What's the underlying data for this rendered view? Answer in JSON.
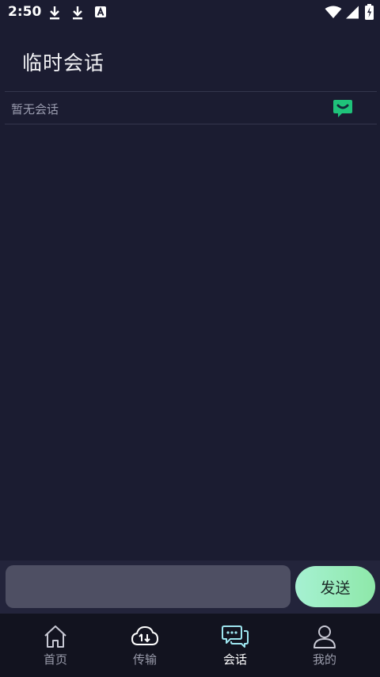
{
  "status_bar": {
    "time": "2:50",
    "icons": [
      "download-icon",
      "download-icon",
      "a-letter-icon",
      "wifi-icon",
      "signal-icon",
      "battery-icon"
    ]
  },
  "page": {
    "title": "临时会话",
    "empty_text": "暂无会话",
    "badge_icon": "chat-smile-icon",
    "badge_color": "#1fc27a"
  },
  "composer": {
    "input_value": "",
    "input_placeholder": "",
    "send_label": "发送",
    "send_gradient": [
      "#a6f1d2",
      "#8ee8a9"
    ]
  },
  "tabs": [
    {
      "label": "首页",
      "icon": "home-icon",
      "active": false
    },
    {
      "label": "传输",
      "icon": "cloud-transfer-icon",
      "active": false
    },
    {
      "label": "会话",
      "icon": "chat-bubbles-icon",
      "active": true
    },
    {
      "label": "我的",
      "icon": "user-icon",
      "active": false
    }
  ]
}
